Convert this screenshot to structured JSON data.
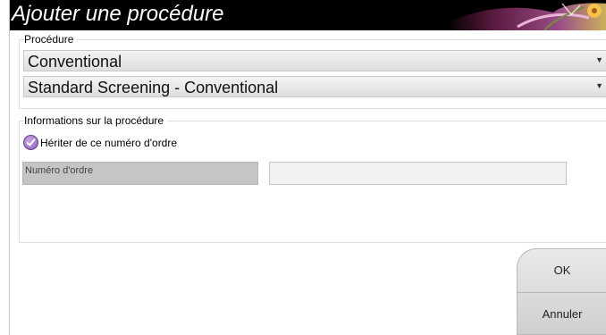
{
  "dialog": {
    "title": "Ajouter une procédure"
  },
  "procedure": {
    "group_label": "Procédure",
    "type_value": "Conventional",
    "name_value": "Standard Screening - Conventional"
  },
  "info": {
    "group_label": "Informations sur la procédure",
    "inherit_label": "Hériter de ce numéro d'ordre",
    "inherit_checked": true,
    "order_number_label": "Numéro d'ordre",
    "order_number_value": ""
  },
  "buttons": {
    "ok_label": "OK",
    "cancel_label": "Annuler"
  },
  "icons": {
    "combo_arrow": "chevron-down-icon",
    "checkbox": "checkmark-icon",
    "banner": "flower-banner-icon"
  },
  "colors": {
    "titlebar": "#000000",
    "checkbox_purple": "#8a5cb8",
    "label_field_bg": "#c7c4c4"
  }
}
